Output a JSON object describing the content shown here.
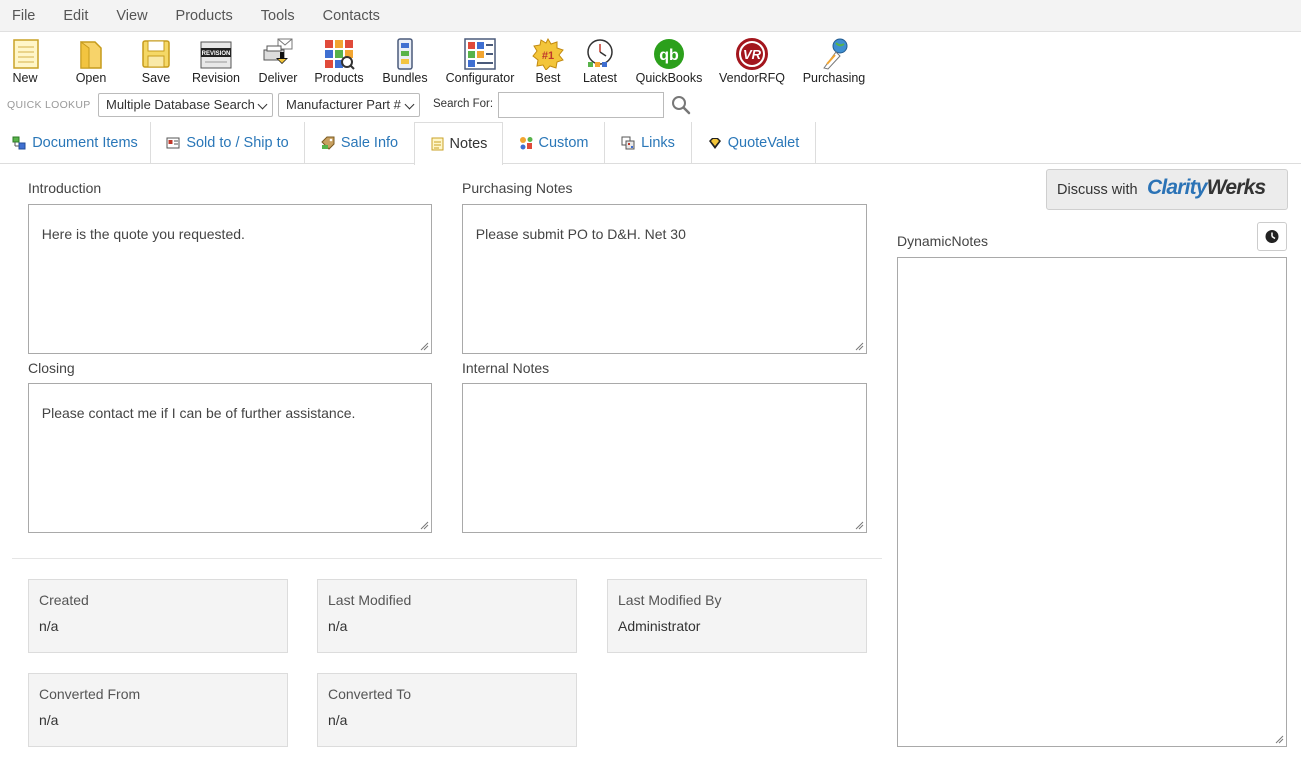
{
  "menu": [
    "File",
    "Edit",
    "View",
    "Products",
    "Tools",
    "Contacts"
  ],
  "toolbar": {
    "new": "New",
    "open": "Open",
    "save": "Save",
    "revision": "Revision",
    "revision_badge": "REVISION",
    "deliver": "Deliver",
    "products": "Products",
    "bundles": "Bundles",
    "configurator": "Configurator",
    "best": "Best",
    "best_badge": "#1",
    "latest": "Latest",
    "quickbooks": "QuickBooks",
    "quickbooks_badge": "qb",
    "vendorrfq": "VendorRFQ",
    "vendorrfq_badge": "VR",
    "purchasing": "Purchasing"
  },
  "quick_lookup": {
    "label": "QUICK LOOKUP",
    "database": "Multiple Database Search",
    "field": "Manufacturer Part #",
    "search_label": "Search For:",
    "search_value": ""
  },
  "tabs": [
    "Document Items",
    "Sold to / Ship to",
    "Sale Info",
    "Notes",
    "Custom",
    "Links",
    "QuoteValet"
  ],
  "active_tab": "Notes",
  "notes": {
    "introduction_label": "Introduction",
    "introduction": "Here is the quote you requested.",
    "purchasing_label": "Purchasing Notes",
    "purchasing": "Please submit PO to D&H. Net 30",
    "closing_label": "Closing",
    "closing": "Please contact me if I can be of further assistance.",
    "internal_label": "Internal Notes",
    "internal": ""
  },
  "info": {
    "created_label": "Created",
    "created": "n/a",
    "modified_label": "Last Modified",
    "modified": "n/a",
    "modified_by_label": "Last Modified By",
    "modified_by": "Administrator",
    "converted_from_label": "Converted From",
    "converted_from": "n/a",
    "converted_to_label": "Converted To",
    "converted_to": "n/a"
  },
  "discuss": {
    "label": "Discuss with",
    "brand_a": "Clarity",
    "brand_b": "Werks"
  },
  "dynamic_notes": {
    "label": "DynamicNotes",
    "value": ""
  },
  "colors": {
    "link": "#2a77b8",
    "brand_blue": "#2b73b6",
    "brand_dark": "#333333",
    "qb_green": "#2ca01c",
    "vr_red": "#a3161d"
  }
}
